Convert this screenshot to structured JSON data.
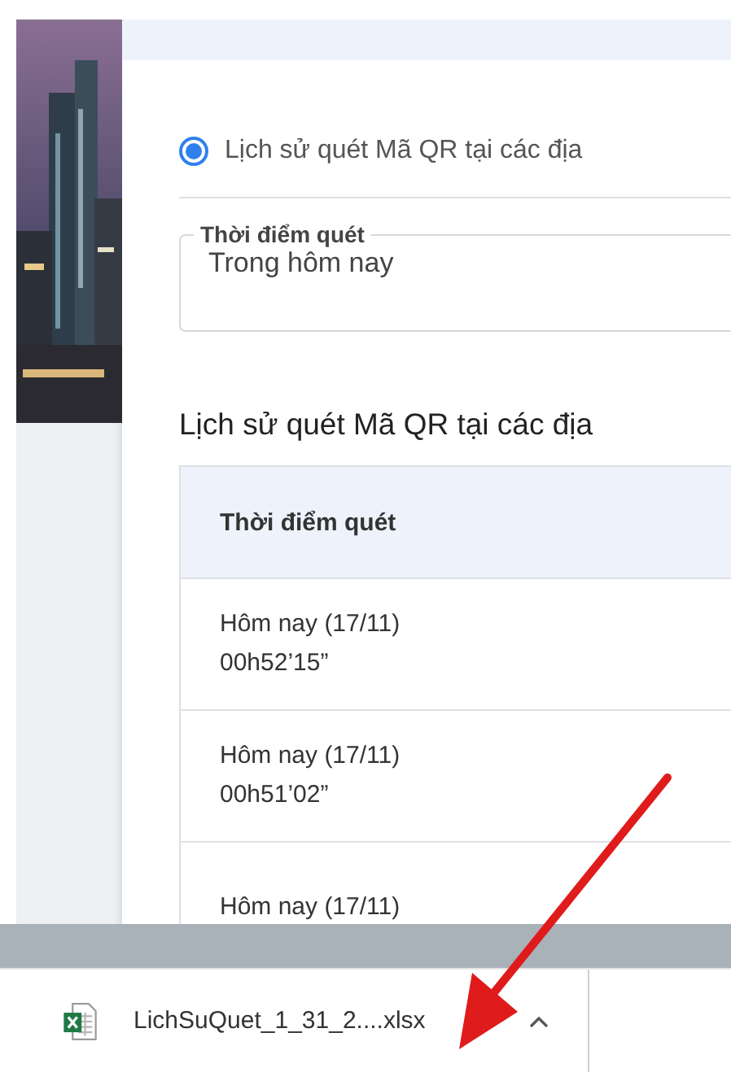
{
  "filter": {
    "options": [
      {
        "label": "Lịch sử quét Mã QR tại các địa",
        "selected": true
      }
    ],
    "field": {
      "label": "Thời điểm quét",
      "value": "Trong hôm nay"
    }
  },
  "section_title": "Lịch sử quét Mã QR tại các địa",
  "table": {
    "columns": [
      "Thời điểm quét"
    ],
    "rows": [
      {
        "lines": [
          "Hôm nay (17/11)",
          "00h52’15”"
        ]
      },
      {
        "lines": [
          "Hôm nay (17/11)",
          "00h51’02”"
        ]
      },
      {
        "lines": [
          "Hôm nay (17/11)"
        ]
      }
    ]
  },
  "download_bar": {
    "items": [
      {
        "filename": "LichSuQuet_1_31_2....xlsx"
      }
    ]
  }
}
